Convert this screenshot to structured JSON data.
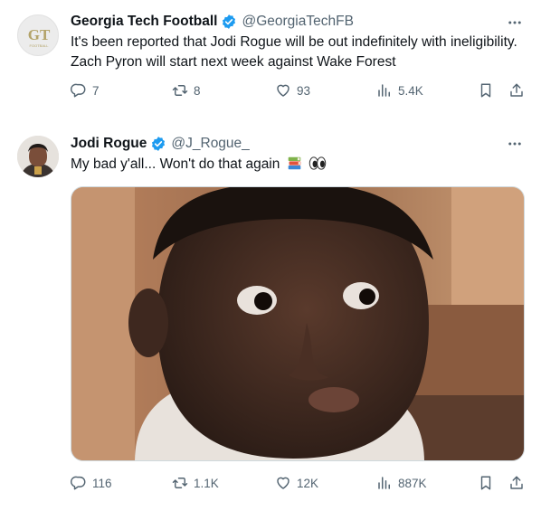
{
  "tweets": [
    {
      "author": "Georgia Tech Football",
      "handle": "@GeorgiaTechFB",
      "avatar_logo": "GT",
      "avatar_sub": "FOOTBALL",
      "text": "It's been reported that Jodi Rogue will be out indefinitely with ineligibility. Zach Pyron will start next week against Wake Forest",
      "replies": "7",
      "retweets": "8",
      "likes": "93",
      "views": "5.4K"
    },
    {
      "author": "Jodi Rogue",
      "handle": "@J_Rogue_",
      "text": "My bad y'all... Won't do that again",
      "emoji": [
        "books-emoji",
        "eyes-emoji"
      ],
      "replies": "116",
      "retweets": "1.1K",
      "likes": "12K",
      "views": "887K"
    }
  ],
  "colors": {
    "verified": "#1d9bf0",
    "secondary_text": "#536471",
    "gt_gold": "#b3a369"
  }
}
